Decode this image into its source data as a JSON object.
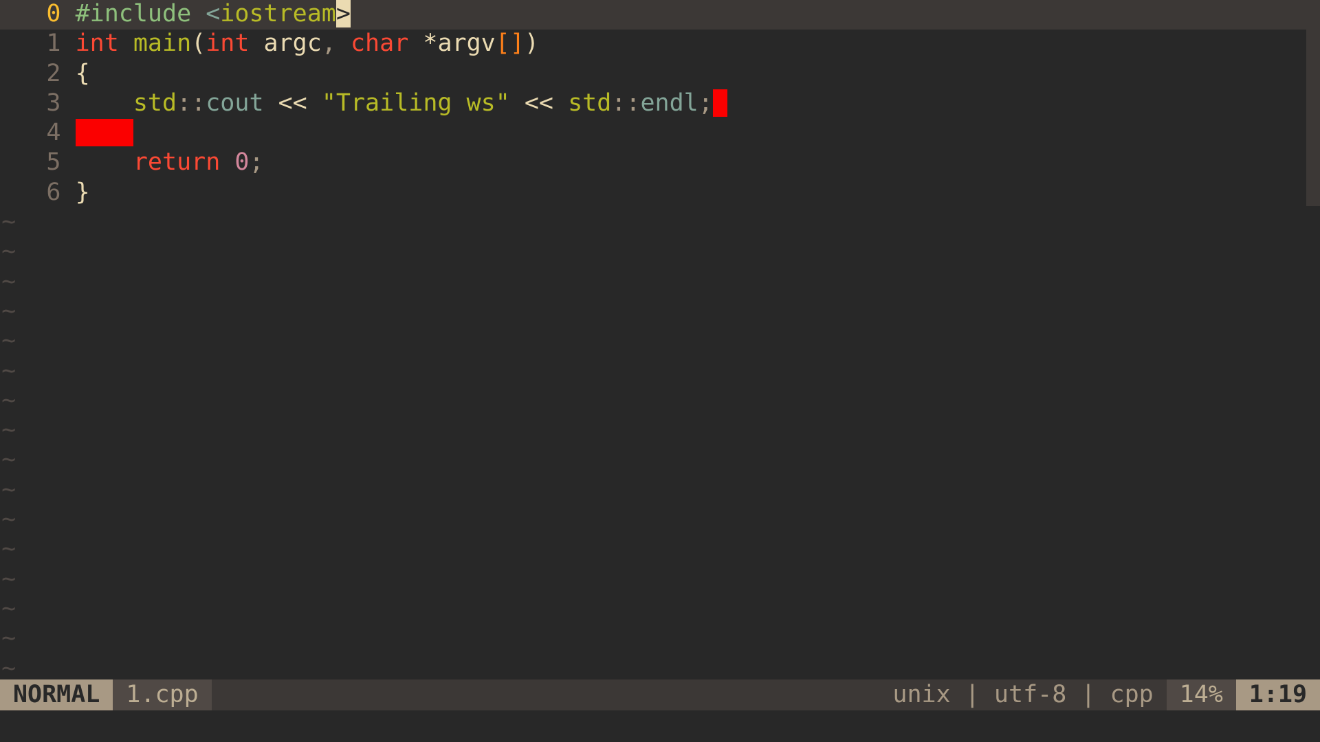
{
  "editor": {
    "mode": "NORMAL",
    "filename": "1.cpp",
    "fileformat": "unix",
    "encoding": "utf-8",
    "filetype": "cpp",
    "percent": "14%",
    "cursor_line": 1,
    "cursor_col": 19,
    "position": "1:19",
    "tilde_char": "~",
    "lines": {
      "l0": {
        "num": "0",
        "preproc": "#include ",
        "lt": "<",
        "incfile": "iostream",
        "gt_cursor": ">"
      },
      "l1": {
        "num": "1",
        "t_int": "int",
        "sp1": " ",
        "fn_main": "main",
        "lp": "(",
        "t_int2": "int",
        "sp2": " ",
        "id_argc": "argc",
        "comma": ",",
        "sp3": " ",
        "t_char": "char",
        "sp4": " ",
        "star": "*",
        "id_argv": "argv",
        "lbrk": "[",
        "rbrk": "]",
        "rp": ")"
      },
      "l2": {
        "num": "2",
        "brace": "{"
      },
      "l3": {
        "num": "3",
        "indent": "    ",
        "ns_std": "std",
        "dcolon1": "::",
        "id_cout": "cout",
        "sp1": " ",
        "op1": "<<",
        "sp2": " ",
        "str": "\"Trailing ws\"",
        "sp3": " ",
        "op2": "<<",
        "sp4": " ",
        "ns_std2": "std",
        "dcolon2": "::",
        "id_endl": "endl",
        "semi": ";",
        "trail": " "
      },
      "l4": {
        "num": "4",
        "trail": "    "
      },
      "l5": {
        "num": "5",
        "indent": "    ",
        "kw_return": "return",
        "sp": " ",
        "zero": "0",
        "semi": ";"
      },
      "l6": {
        "num": "6",
        "brace": "}"
      }
    },
    "status_separator": " | "
  }
}
